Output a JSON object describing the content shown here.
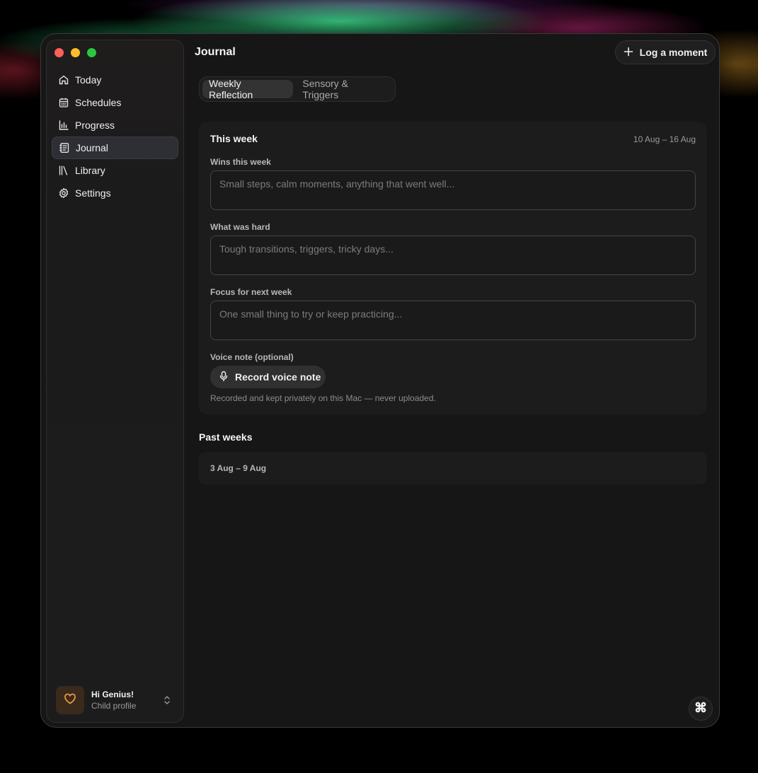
{
  "app": {
    "title": "Journal"
  },
  "sidebar": {
    "items": [
      {
        "label": "Today",
        "icon": "home-icon"
      },
      {
        "label": "Schedules",
        "icon": "calendar-icon"
      },
      {
        "label": "Progress",
        "icon": "bar-chart-icon"
      },
      {
        "label": "Journal",
        "icon": "journal-icon",
        "active": true
      },
      {
        "label": "Library",
        "icon": "library-icon"
      },
      {
        "label": "Settings",
        "icon": "gear-icon"
      }
    ],
    "profile": {
      "name": "Hi Genius!",
      "subtitle": "Child profile",
      "icon": "heart-icon"
    }
  },
  "header": {
    "log_button": "Log a moment"
  },
  "tabs": [
    {
      "label": "Weekly Reflection",
      "active": true
    },
    {
      "label": "Sensory & Triggers",
      "active": false
    }
  ],
  "this_week": {
    "title": "This week",
    "range": "10 Aug – 16 Aug",
    "wins": {
      "label": "Wins this week",
      "value": "",
      "placeholder": "Small steps, calm moments, anything that went well..."
    },
    "hard": {
      "label": "What was hard",
      "value": "",
      "placeholder": "Tough transitions, triggers, tricky days..."
    },
    "focus": {
      "label": "Focus for next week",
      "value": "",
      "placeholder": "One small thing to try or keep practicing..."
    },
    "voice": {
      "label": "Voice note (optional)",
      "button": "Record voice note",
      "note": "Recorded and kept privately on this Mac — never uploaded."
    }
  },
  "past_weeks": {
    "title": "Past weeks",
    "items": [
      "3 Aug – 9 Aug"
    ]
  },
  "colors": {
    "accent_heart": "#f0a040",
    "background": "#161616",
    "card": "#1c1c1c"
  }
}
